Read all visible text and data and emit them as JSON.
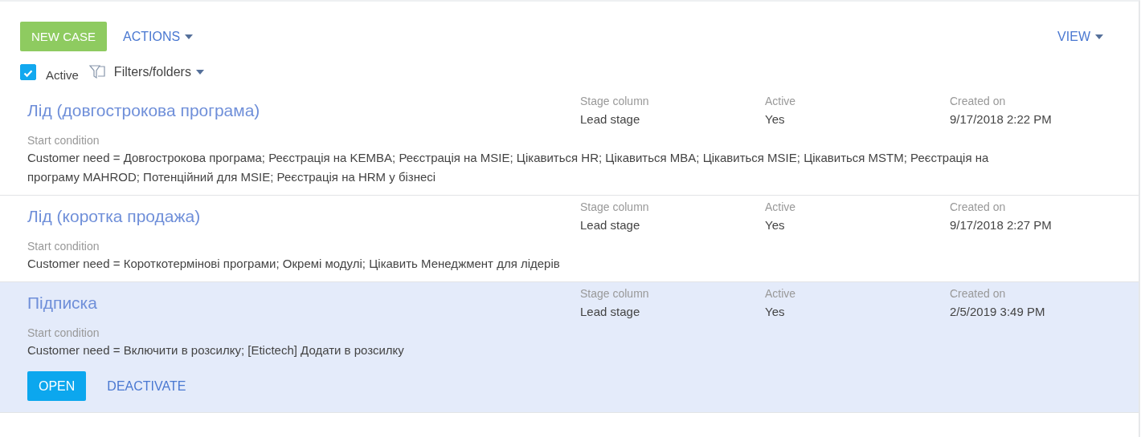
{
  "toolbar": {
    "new_case": "NEW CASE",
    "actions": "ACTIONS",
    "view": "VIEW"
  },
  "filter": {
    "active": {
      "label": "Active",
      "checked": true
    },
    "filters_folders": "Filters/folders"
  },
  "records": [
    {
      "title": "Лід (довгострокова програма)",
      "selected": false,
      "columns": [
        {
          "label": "Stage column",
          "value": "Lead stage"
        },
        {
          "label": "Active",
          "value": "Yes"
        },
        {
          "label": "Created on",
          "value": "9/17/2018 2:22 PM"
        }
      ],
      "condition_label": "Start condition",
      "condition": "Customer need = Довгострокова програма; Реєстрація на KEMBA; Реєстрація на MSIE; Цікавиться HR; Цікавиться MBA; Цікавиться MSIE; Цікавиться MSTM; Реєстрація на програму MAHROD; Потенційний для MSIE; Реєстрація на HRM у бізнесі"
    },
    {
      "title": "Лід (коротка продажа)",
      "selected": false,
      "columns": [
        {
          "label": "Stage column",
          "value": "Lead stage"
        },
        {
          "label": "Active",
          "value": "Yes"
        },
        {
          "label": "Created on",
          "value": "9/17/2018 2:27 PM"
        }
      ],
      "condition_label": "Start condition",
      "condition": "Customer need = Короткотермінові програми; Окремі модулі; Цікавить Менеджмент для лідерів"
    },
    {
      "title": "Підписка",
      "selected": true,
      "columns": [
        {
          "label": "Stage column",
          "value": "Lead stage"
        },
        {
          "label": "Active",
          "value": "Yes"
        },
        {
          "label": "Created on",
          "value": "2/5/2019 3:49 PM"
        }
      ],
      "condition_label": "Start condition",
      "condition": "Customer need = Включити в розсилку; [Etictech] Додати в розсилку",
      "actions": [
        {
          "label": "OPEN",
          "kind": "primary"
        },
        {
          "label": "DEACTIVATE",
          "kind": "link"
        }
      ]
    }
  ]
}
